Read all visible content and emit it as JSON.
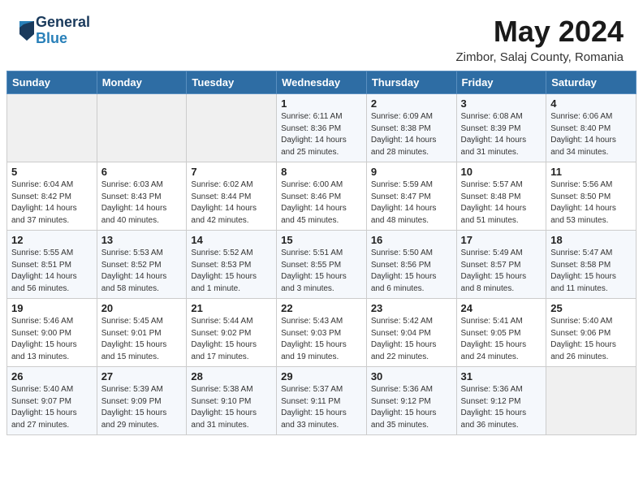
{
  "header": {
    "logo_general": "General",
    "logo_blue": "Blue",
    "month_title": "May 2024",
    "location": "Zimbor, Salaj County, Romania"
  },
  "weekdays": [
    "Sunday",
    "Monday",
    "Tuesday",
    "Wednesday",
    "Thursday",
    "Friday",
    "Saturday"
  ],
  "weeks": [
    [
      {
        "day": "",
        "info": ""
      },
      {
        "day": "",
        "info": ""
      },
      {
        "day": "",
        "info": ""
      },
      {
        "day": "1",
        "info": "Sunrise: 6:11 AM\nSunset: 8:36 PM\nDaylight: 14 hours\nand 25 minutes."
      },
      {
        "day": "2",
        "info": "Sunrise: 6:09 AM\nSunset: 8:38 PM\nDaylight: 14 hours\nand 28 minutes."
      },
      {
        "day": "3",
        "info": "Sunrise: 6:08 AM\nSunset: 8:39 PM\nDaylight: 14 hours\nand 31 minutes."
      },
      {
        "day": "4",
        "info": "Sunrise: 6:06 AM\nSunset: 8:40 PM\nDaylight: 14 hours\nand 34 minutes."
      }
    ],
    [
      {
        "day": "5",
        "info": "Sunrise: 6:04 AM\nSunset: 8:42 PM\nDaylight: 14 hours\nand 37 minutes."
      },
      {
        "day": "6",
        "info": "Sunrise: 6:03 AM\nSunset: 8:43 PM\nDaylight: 14 hours\nand 40 minutes."
      },
      {
        "day": "7",
        "info": "Sunrise: 6:02 AM\nSunset: 8:44 PM\nDaylight: 14 hours\nand 42 minutes."
      },
      {
        "day": "8",
        "info": "Sunrise: 6:00 AM\nSunset: 8:46 PM\nDaylight: 14 hours\nand 45 minutes."
      },
      {
        "day": "9",
        "info": "Sunrise: 5:59 AM\nSunset: 8:47 PM\nDaylight: 14 hours\nand 48 minutes."
      },
      {
        "day": "10",
        "info": "Sunrise: 5:57 AM\nSunset: 8:48 PM\nDaylight: 14 hours\nand 51 minutes."
      },
      {
        "day": "11",
        "info": "Sunrise: 5:56 AM\nSunset: 8:50 PM\nDaylight: 14 hours\nand 53 minutes."
      }
    ],
    [
      {
        "day": "12",
        "info": "Sunrise: 5:55 AM\nSunset: 8:51 PM\nDaylight: 14 hours\nand 56 minutes."
      },
      {
        "day": "13",
        "info": "Sunrise: 5:53 AM\nSunset: 8:52 PM\nDaylight: 14 hours\nand 58 minutes."
      },
      {
        "day": "14",
        "info": "Sunrise: 5:52 AM\nSunset: 8:53 PM\nDaylight: 15 hours\nand 1 minute."
      },
      {
        "day": "15",
        "info": "Sunrise: 5:51 AM\nSunset: 8:55 PM\nDaylight: 15 hours\nand 3 minutes."
      },
      {
        "day": "16",
        "info": "Sunrise: 5:50 AM\nSunset: 8:56 PM\nDaylight: 15 hours\nand 6 minutes."
      },
      {
        "day": "17",
        "info": "Sunrise: 5:49 AM\nSunset: 8:57 PM\nDaylight: 15 hours\nand 8 minutes."
      },
      {
        "day": "18",
        "info": "Sunrise: 5:47 AM\nSunset: 8:58 PM\nDaylight: 15 hours\nand 11 minutes."
      }
    ],
    [
      {
        "day": "19",
        "info": "Sunrise: 5:46 AM\nSunset: 9:00 PM\nDaylight: 15 hours\nand 13 minutes."
      },
      {
        "day": "20",
        "info": "Sunrise: 5:45 AM\nSunset: 9:01 PM\nDaylight: 15 hours\nand 15 minutes."
      },
      {
        "day": "21",
        "info": "Sunrise: 5:44 AM\nSunset: 9:02 PM\nDaylight: 15 hours\nand 17 minutes."
      },
      {
        "day": "22",
        "info": "Sunrise: 5:43 AM\nSunset: 9:03 PM\nDaylight: 15 hours\nand 19 minutes."
      },
      {
        "day": "23",
        "info": "Sunrise: 5:42 AM\nSunset: 9:04 PM\nDaylight: 15 hours\nand 22 minutes."
      },
      {
        "day": "24",
        "info": "Sunrise: 5:41 AM\nSunset: 9:05 PM\nDaylight: 15 hours\nand 24 minutes."
      },
      {
        "day": "25",
        "info": "Sunrise: 5:40 AM\nSunset: 9:06 PM\nDaylight: 15 hours\nand 26 minutes."
      }
    ],
    [
      {
        "day": "26",
        "info": "Sunrise: 5:40 AM\nSunset: 9:07 PM\nDaylight: 15 hours\nand 27 minutes."
      },
      {
        "day": "27",
        "info": "Sunrise: 5:39 AM\nSunset: 9:09 PM\nDaylight: 15 hours\nand 29 minutes."
      },
      {
        "day": "28",
        "info": "Sunrise: 5:38 AM\nSunset: 9:10 PM\nDaylight: 15 hours\nand 31 minutes."
      },
      {
        "day": "29",
        "info": "Sunrise: 5:37 AM\nSunset: 9:11 PM\nDaylight: 15 hours\nand 33 minutes."
      },
      {
        "day": "30",
        "info": "Sunrise: 5:36 AM\nSunset: 9:12 PM\nDaylight: 15 hours\nand 35 minutes."
      },
      {
        "day": "31",
        "info": "Sunrise: 5:36 AM\nSunset: 9:12 PM\nDaylight: 15 hours\nand 36 minutes."
      },
      {
        "day": "",
        "info": ""
      }
    ]
  ]
}
